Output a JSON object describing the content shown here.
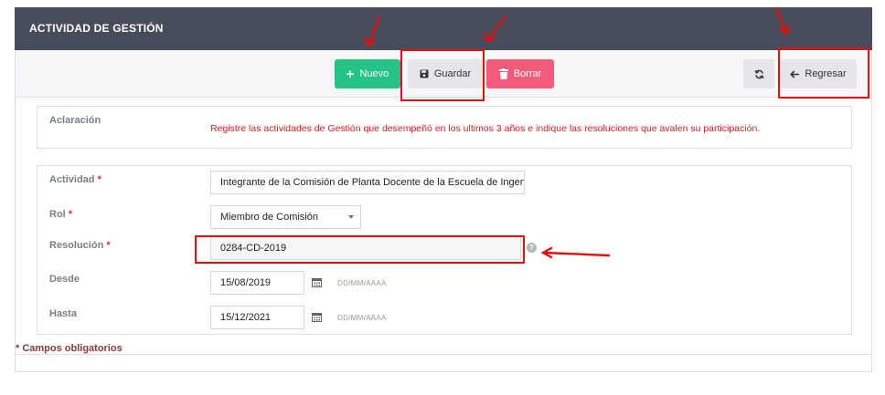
{
  "header": {
    "title": "ACTIVIDAD DE GESTIÓN"
  },
  "toolbar": {
    "nuevo_label": "Nuevo",
    "guardar_label": "Guardar",
    "borrar_label": "Borrar",
    "regresar_label": "Regresar"
  },
  "aclaracion": {
    "label": "Aclaración",
    "text": "Registre las actividades de Gestión que desempeñó en los ultimos 3 años e indique las resoluciones que avalen su participación."
  },
  "form": {
    "actividad": {
      "label": "Actividad",
      "required_mark": "*",
      "value": "Integrante de la Comisión de Planta Docente de la Escuela de Ingeniería"
    },
    "rol": {
      "label": "Rol",
      "required_mark": "*",
      "value": "Miembro de Comisión"
    },
    "resolucion": {
      "label": "Resolución",
      "required_mark": "*",
      "value": "0284-CD-2019"
    },
    "desde": {
      "label": "Desde",
      "value": "15/08/2019",
      "format_hint": "DD/MM/AAAA"
    },
    "hasta": {
      "label": "Hasta",
      "value": "15/12/2021",
      "format_hint": "DD/MM/AAAA"
    }
  },
  "footer": {
    "required_note": "* Campos obligatorios"
  },
  "colors": {
    "header_bg": "#464c59",
    "nuevo_green": "#24c484",
    "borrar_red": "#f25b7a",
    "annotation_red": "#e31010"
  }
}
